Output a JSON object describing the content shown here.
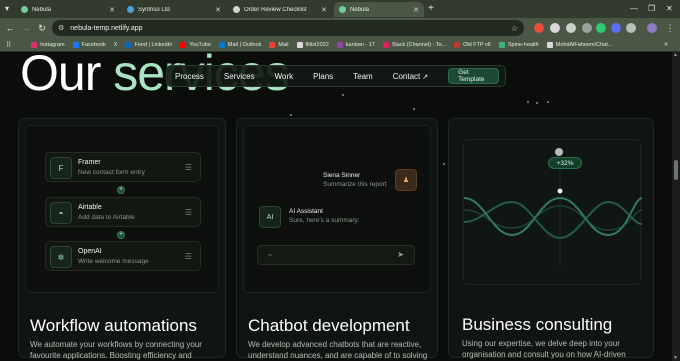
{
  "browser": {
    "tabs": [
      {
        "label": "Nebula",
        "fav": "#6fcf97",
        "active": false
      },
      {
        "label": "Syntriso Ltd",
        "fav": "#4aa3df",
        "active": false
      },
      {
        "label": "Order Review Checklist",
        "fav": "#cfd6ca",
        "active": false
      },
      {
        "label": "Nebula",
        "fav": "#6fcf97",
        "active": true
      }
    ],
    "new_tab": "+",
    "url": "nebula-temp.netlify.app",
    "bookmarks": [
      "Instagram",
      "Facebook",
      "X",
      "Feed | LinkedIn",
      "YouTube",
      "Mail | Outlook",
      "Mail",
      "fitlist2022",
      "kanban - 17",
      "Slack (Channel) - To...",
      "Old FTP v6",
      "Spine-health",
      "MohdAlFaheem/Chat..."
    ],
    "bookmark_colors": [
      "#e1306c",
      "#1877f2",
      "#ffffff",
      "#0a66c2",
      "#ff0000",
      "#0078d4",
      "#ea4335",
      "#d9d9d9",
      "#8e44ad",
      "#e01e5a",
      "#c0392b",
      "#3bb273",
      "#d9d9d9"
    ],
    "more_bookmarks": "»"
  },
  "hero": {
    "title_plain": "Our ",
    "title_accent": "services"
  },
  "nav": {
    "links": [
      "Process",
      "Services",
      "Work",
      "Plans",
      "Team",
      "Contact"
    ],
    "contact_arrow": "↗",
    "cta": "Get Template"
  },
  "cards": {
    "workflow": {
      "items": [
        {
          "icon": "framer-icon",
          "glyph": "F",
          "title": "Framer",
          "subtitle": "New contact form entry"
        },
        {
          "icon": "airtable-icon",
          "glyph": "◓",
          "title": "Airtable",
          "subtitle": "Add data to Airtable"
        },
        {
          "icon": "openai-icon",
          "glyph": "✲",
          "title": "OpenAI",
          "subtitle": "Write welcome message"
        }
      ],
      "title": "Workflow automations",
      "description": "We automate your workflows by connecting your favourite applications. Boosting efficiency and"
    },
    "chatbot": {
      "user_name": "Siena Sinner",
      "user_text": "Summarize this report",
      "ai_badge": "AI",
      "ai_name": "AI Assistant",
      "ai_text": "Sure, here's a summary:",
      "input_placeholder": "⌁",
      "send_icon": "➤",
      "title": "Chatbot development",
      "description": "We develop advanced chatbots that are reactive, understand nuances, and are capable of to solving"
    },
    "consulting": {
      "pill": "+32%",
      "title": "Business consulting",
      "description": "Using our expertise, we delve deep into your organisation and consult you on how AI-driven"
    }
  },
  "colors": {
    "accent": "#a9e4c2",
    "panel": "#111511",
    "wave": "#3f9e74"
  }
}
